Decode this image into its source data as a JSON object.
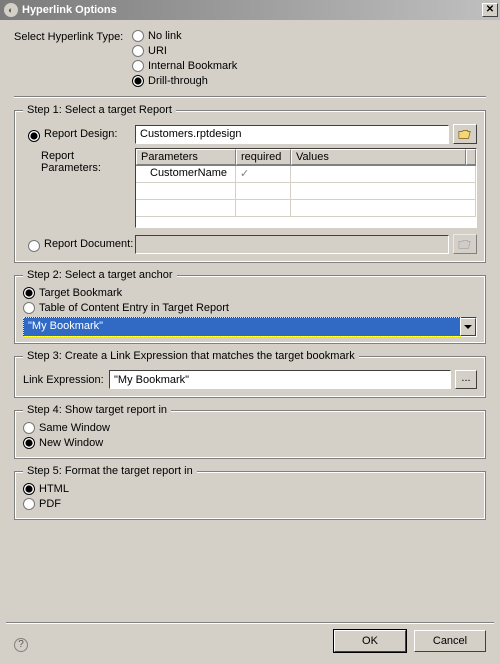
{
  "window": {
    "title": "Hyperlink Options"
  },
  "type_section": {
    "label": "Select Hyperlink Type:",
    "options": {
      "nolink": "No link",
      "uri": "URI",
      "bookmark": "Internal Bookmark",
      "drill": "Drill-through"
    },
    "selected": "drill"
  },
  "step1": {
    "legend": "Step 1: Select a target Report",
    "design_radio": "Report Design:",
    "design_value": "Customers.rptdesign",
    "params_label": "Report Parameters:",
    "params_headers": {
      "c1": "Parameters",
      "c2": "required",
      "c3": "Values"
    },
    "params_rows": [
      {
        "name": "CustomerName",
        "required": "✓",
        "value": ""
      }
    ],
    "doc_radio": "Report Document:",
    "doc_value": ""
  },
  "step2": {
    "legend": "Step 2: Select a target anchor",
    "target_bookmark": "Target Bookmark",
    "toc_entry": "Table of Content Entry in Target Report",
    "dropdown_value": "\"My Bookmark\""
  },
  "step3": {
    "legend": "Step 3: Create a Link Expression that matches the target bookmark",
    "label": "Link Expression:",
    "value": "\"My Bookmark\""
  },
  "step4": {
    "legend": "Step 4: Show target report in",
    "same": "Same Window",
    "neww": "New Window"
  },
  "step5": {
    "legend": "Step 5: Format the target report in",
    "html": "HTML",
    "pdf": "PDF"
  },
  "buttons": {
    "ok": "OK",
    "cancel": "Cancel"
  }
}
